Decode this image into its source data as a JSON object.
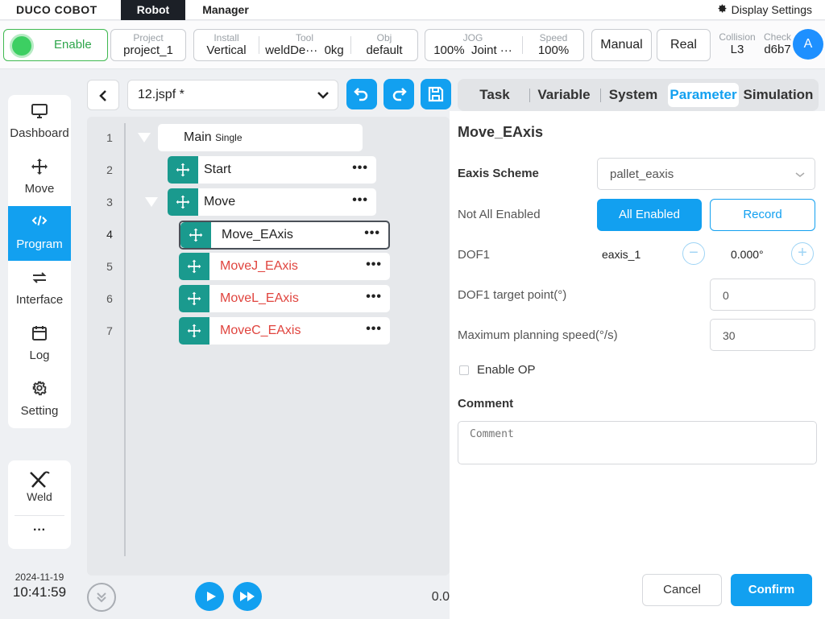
{
  "topbar": {
    "logo": "DUCO COBOT",
    "tabs": [
      "Robot",
      "Manager"
    ],
    "display_settings": "Display Settings"
  },
  "status": {
    "enable": "Enable",
    "project": {
      "label": "Project",
      "value": "project_1"
    },
    "install": {
      "label": "Install",
      "value": "Vertical"
    },
    "tool": {
      "label": "Tool",
      "value": "weldDe···",
      "weight": "0kg"
    },
    "obj": {
      "label": "Obj",
      "value": "default"
    },
    "jog": {
      "label": "JOG",
      "value": "100%",
      "mode": "Joint ···"
    },
    "speed": {
      "label": "Speed",
      "value": "100%"
    },
    "manual": "Manual",
    "real": "Real",
    "collision": {
      "label": "Collision",
      "value": "L3"
    },
    "check": {
      "label": "Check",
      "value": "d6b7"
    },
    "avatar": "A"
  },
  "sidebar": {
    "items": [
      {
        "label": "Dashboard",
        "icon": "monitor-icon"
      },
      {
        "label": "Move",
        "icon": "move-icon"
      },
      {
        "label": "Program",
        "icon": "code-icon",
        "active": true
      },
      {
        "label": "Interface",
        "icon": "swap-icon"
      },
      {
        "label": "Log",
        "icon": "calendar-icon"
      },
      {
        "label": "Setting",
        "icon": "gear-icon"
      }
    ],
    "weld": "Weld",
    "more": "···",
    "date": "2024-11-19",
    "time": "10:41:59"
  },
  "program": {
    "file": "12.jspf *",
    "lines": [
      {
        "num": "1",
        "text": "Main",
        "sub": "Single"
      },
      {
        "num": "2",
        "text": "Start"
      },
      {
        "num": "3",
        "text": "Move"
      },
      {
        "num": "4",
        "text": "Move_EAxis"
      },
      {
        "num": "5",
        "text": "MoveJ_EAxis"
      },
      {
        "num": "6",
        "text": "MoveL_EAxis"
      },
      {
        "num": "7",
        "text": "MoveC_EAxis"
      }
    ],
    "dots": "•••",
    "progress": "0.0"
  },
  "tabs": [
    "Task",
    "Variable",
    "System",
    "Parameter",
    "Simulation"
  ],
  "params": {
    "title": "Move_EAxis",
    "scheme_label": "Eaxis Scheme",
    "scheme_value": "pallet_eaxis",
    "not_all_enabled": "Not All Enabled",
    "all_enabled": "All Enabled",
    "record": "Record",
    "dof1_label": "DOF1",
    "dof1_axis": "eaxis_1",
    "dof1_value": "0.000°",
    "target_label": "DOF1 target point(°)",
    "target_value": "0",
    "speed_label": "Maximum planning speed(°/s)",
    "speed_value": "30",
    "enable_op": "Enable OP",
    "comment_label": "Comment",
    "comment_placeholder": "Comment",
    "cancel": "Cancel",
    "confirm": "Confirm"
  },
  "colors": {
    "accent": "#12a0f0",
    "node_icon": "#1a9a8e",
    "error_text": "#e0443e",
    "enable_green": "#3ccf62"
  }
}
